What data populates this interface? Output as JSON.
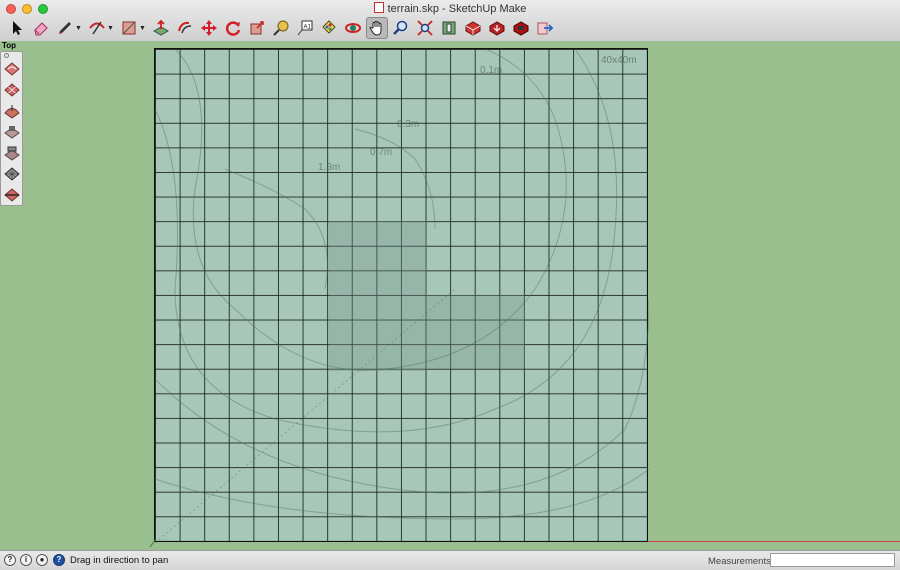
{
  "window": {
    "title": "terrain.skp - SketchUp Make"
  },
  "toolbar": {
    "tools": [
      {
        "name": "select-tool",
        "icon": "arrow-cursor-icon"
      },
      {
        "name": "eraser-tool",
        "icon": "eraser-icon"
      },
      {
        "name": "line-tool",
        "icon": "pencil-icon",
        "has_dropdown": true
      },
      {
        "name": "arc-tool",
        "icon": "arc-icon",
        "has_dropdown": true
      },
      {
        "name": "rectangle-tool",
        "icon": "rectangle-icon",
        "has_dropdown": true
      },
      {
        "name": "push-pull-tool",
        "icon": "push-pull-icon"
      },
      {
        "name": "offset-tool",
        "icon": "offset-icon"
      },
      {
        "name": "move-tool",
        "icon": "move-arrows-icon"
      },
      {
        "name": "rotate-tool",
        "icon": "rotate-icon"
      },
      {
        "name": "scale-tool",
        "icon": "scale-icon"
      },
      {
        "name": "tape-measure-tool",
        "icon": "tape-measure-icon"
      },
      {
        "name": "text-tool",
        "icon": "text-label-icon"
      },
      {
        "name": "paint-bucket-tool",
        "icon": "paint-bucket-icon"
      },
      {
        "name": "orbit-tool",
        "icon": "orbit-icon"
      },
      {
        "name": "pan-tool",
        "icon": "hand-icon",
        "active": true
      },
      {
        "name": "zoom-tool",
        "icon": "magnifier-icon"
      },
      {
        "name": "zoom-extents-tool",
        "icon": "zoom-extents-icon"
      },
      {
        "name": "3d-warehouse-tool",
        "icon": "warehouse-icon"
      },
      {
        "name": "share-model-tool",
        "icon": "share-model-icon"
      },
      {
        "name": "get-models-tool",
        "icon": "get-models-icon"
      },
      {
        "name": "extension-warehouse-tool",
        "icon": "extension-warehouse-icon"
      },
      {
        "name": "send-to-layout-tool",
        "icon": "send-to-layout-icon"
      }
    ]
  },
  "viewport": {
    "view_name": "Top",
    "terrain": {
      "size_label": "40x40m",
      "contour_labels": [
        "0.1m",
        "0.3m",
        "0.7m",
        "1.3m"
      ],
      "grid_cells": 20
    }
  },
  "sandbox_palette": {
    "tools": [
      {
        "name": "from-contours",
        "icon": "sandbox-contours-icon"
      },
      {
        "name": "from-scratch",
        "icon": "sandbox-scratch-icon"
      },
      {
        "name": "smoove",
        "icon": "smoove-icon"
      },
      {
        "name": "stamp",
        "icon": "stamp-icon"
      },
      {
        "name": "drape",
        "icon": "drape-icon"
      },
      {
        "name": "add-detail",
        "icon": "add-detail-icon"
      },
      {
        "name": "flip-edge",
        "icon": "flip-edge-icon"
      }
    ]
  },
  "statusbar": {
    "hint": "Drag in direction to pan",
    "measurements_label": "Measurements",
    "measurements_value": "",
    "icons": [
      "geo-location-icon",
      "credits-icon",
      "user-icon",
      "help-icon"
    ]
  },
  "colors": {
    "background": "#98bf8d",
    "terrain_fill": "#a7c8b8",
    "red_axis": "#cc4444",
    "help_icon": "#1e4f9b"
  }
}
